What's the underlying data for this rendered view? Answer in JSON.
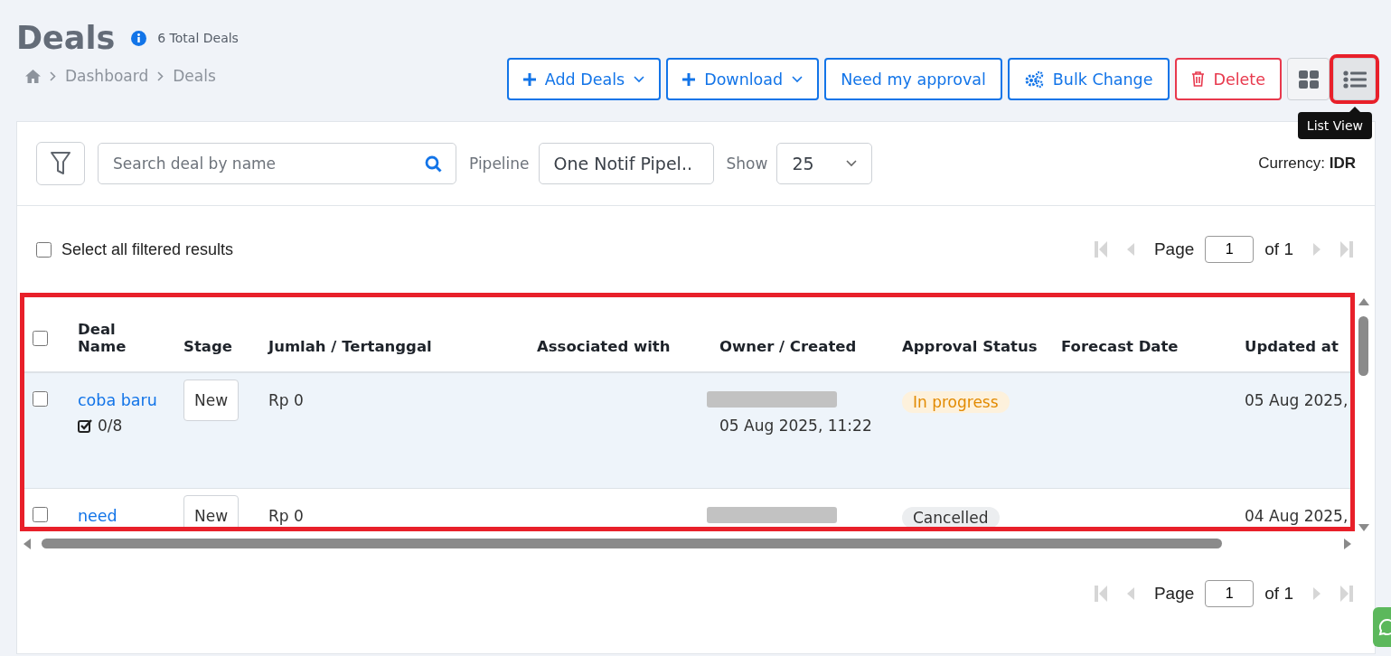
{
  "header": {
    "title": "Deals",
    "total": "6 Total Deals"
  },
  "breadcrumb": [
    "Dashboard",
    "Deals"
  ],
  "actions": [
    {
      "kind": "add",
      "label": "Add Deals"
    },
    {
      "kind": "download",
      "label": "Download"
    },
    {
      "kind": "approval",
      "label": "Need my approval"
    },
    {
      "kind": "bulk",
      "label": "Bulk Change"
    },
    {
      "kind": "delete",
      "label": "Delete"
    }
  ],
  "views": [
    {
      "kind": "grid",
      "selected": false,
      "highlighted": false
    },
    {
      "kind": "list",
      "selected": true,
      "highlighted": true,
      "tooltip": "List View"
    }
  ],
  "filters": {
    "search": {
      "placeholder": "Search deal by name"
    },
    "pipeline": {
      "label": "Pipeline",
      "value": "One Notif Pipel.."
    },
    "show": {
      "label": "Show",
      "value": "25"
    },
    "currency": {
      "label": "Currency:",
      "value": "IDR"
    }
  },
  "select_all": {
    "label": "Select all filtered results",
    "checked": false
  },
  "pagination_top": {
    "label": "Page",
    "value": "1",
    "total": "of 1"
  },
  "table": {
    "highlighted": true,
    "header_checked": false,
    "columns": [
      "Deal Name",
      "Stage",
      "Jumlah / Tertanggal",
      "Associated with",
      "Owner / Created",
      "Approval Status",
      "Forecast Date",
      "Updated at"
    ],
    "rows": [
      {
        "checked": false,
        "hovered": true,
        "name": "coba baru",
        "tasks": "0/8",
        "stage": "New",
        "amount": "Rp 0",
        "created": "05 Aug 2025, 11:22",
        "approval": {
          "kind": "progress",
          "label": "In progress"
        },
        "updated": "05 Aug 2025,"
      },
      {
        "checked": false,
        "hovered": false,
        "name": "need",
        "stage": "New",
        "amount": "Rp 0",
        "approval": {
          "kind": "cancelled",
          "label": "Cancelled"
        },
        "updated": "04 Aug 2025,"
      }
    ]
  },
  "pagination_bottom": {
    "label": "Page",
    "value": "1",
    "total": "of 1"
  }
}
